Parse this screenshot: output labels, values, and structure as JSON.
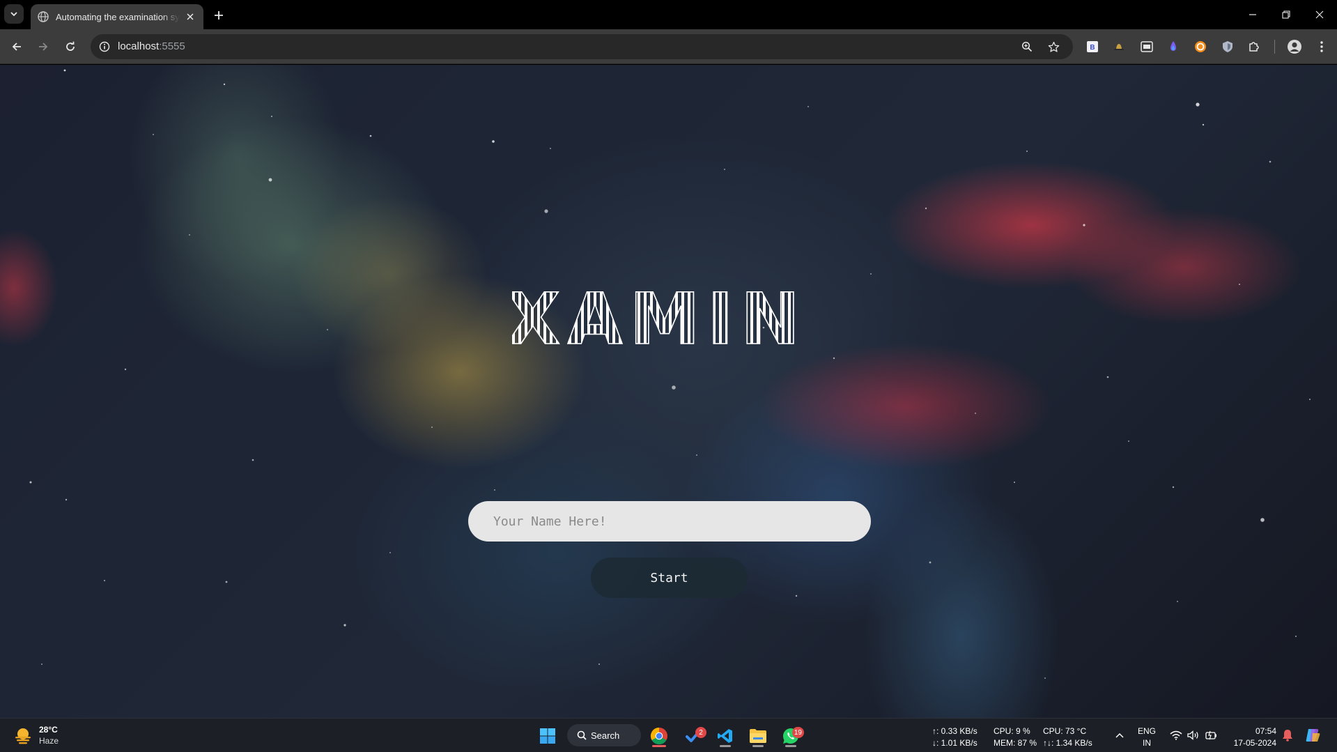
{
  "browser": {
    "tab_title": "Automating the examination sy",
    "url_host": "localhost",
    "url_port": ":5555"
  },
  "page": {
    "logo_text": "XAMIN",
    "name_placeholder": "Your Name Here!",
    "start_label": "Start"
  },
  "taskbar": {
    "weather_temp": "28°C",
    "weather_condition": "Haze",
    "search_label": "Search",
    "todo_badge": "2",
    "whatsapp_badge": "19",
    "net_up": "↑: 0.33 KB/s",
    "net_down": "↓: 1.01 KB/s",
    "cpu_usage": "CPU: 9 %",
    "mem_usage": "MEM: 87 %",
    "cpu_temp": "CPU: 73 °C",
    "net_total": "↑↓: 1.34 KB/s",
    "lang_1": "ENG",
    "lang_2": "IN",
    "time": "07:54",
    "date": "17-05-2024"
  },
  "colors": {
    "chrome_bg": "#3c3c3c",
    "tab_bar_bg": "#000000",
    "input_bg": "#e6e6e6",
    "start_button_bg": "#1c2a34",
    "taskbar_bg": "#1c2026",
    "badge_red": "#e04848"
  },
  "icons": {
    "tab_list": "chevron-down-icon",
    "favicon": "globe-icon",
    "tab_close": "close-icon",
    "new_tab": "plus-icon",
    "back": "arrow-left-icon",
    "forward": "arrow-right-icon",
    "reload": "reload-icon",
    "site_info": "info-icon",
    "zoom": "zoom-icon",
    "bookmark": "star-icon",
    "extensions": "puzzle-icon",
    "menu": "kebab-menu-icon"
  }
}
